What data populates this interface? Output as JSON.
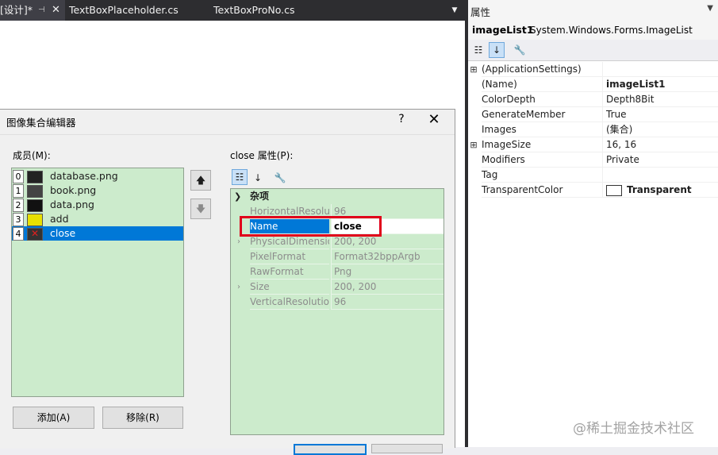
{
  "tabs": [
    {
      "label": "[设计]*",
      "active": true
    },
    {
      "label": "TextBoxPlaceholder.cs",
      "active": false
    },
    {
      "label": "TextBoxProNo.cs",
      "active": false
    }
  ],
  "dialog": {
    "title": "图像集合编辑器",
    "help": "?",
    "close": "✕",
    "members_label": "成员(M):",
    "props_label": "close 属性(P):",
    "members": [
      {
        "index": "0",
        "name": "database.png",
        "selected": false
      },
      {
        "index": "1",
        "name": "book.png",
        "selected": false
      },
      {
        "index": "2",
        "name": "data.png",
        "selected": false
      },
      {
        "index": "3",
        "name": "add",
        "selected": false
      },
      {
        "index": "4",
        "name": "close",
        "selected": true
      }
    ],
    "move_up": "🡅",
    "move_down": "🡇",
    "add_button": "添加(A)",
    "remove_button": "移除(R)",
    "grid": {
      "category": "杂项",
      "rows": [
        {
          "name": "HorizontalResolu",
          "value": "96",
          "expand": ""
        },
        {
          "name": "Name",
          "value": "close",
          "expand": "",
          "selected": true
        },
        {
          "name": "PhysicalDimensio",
          "value": "200, 200",
          "expand": "›"
        },
        {
          "name": "PixelFormat",
          "value": "Format32bppArgb",
          "expand": ""
        },
        {
          "name": "RawFormat",
          "value": "Png",
          "expand": ""
        },
        {
          "name": "Size",
          "value": "200, 200",
          "expand": "›"
        },
        {
          "name": "VerticalResolutio",
          "value": "96",
          "expand": ""
        }
      ]
    }
  },
  "properties": {
    "title": "属性",
    "object_name": "imageList1",
    "object_type": "System.Windows.Forms.ImageList",
    "rows": [
      {
        "name": "(ApplicationSettings)",
        "value": "",
        "expand": "⊞",
        "bold": false
      },
      {
        "name": "(Name)",
        "value": "imageList1",
        "expand": "",
        "bold": true
      },
      {
        "name": "ColorDepth",
        "value": "Depth8Bit",
        "expand": "",
        "bold": false
      },
      {
        "name": "GenerateMember",
        "value": "True",
        "expand": "",
        "bold": false
      },
      {
        "name": "Images",
        "value": "(集合)",
        "expand": "",
        "bold": false
      },
      {
        "name": "ImageSize",
        "value": "16, 16",
        "expand": "⊞",
        "bold": false
      },
      {
        "name": "Modifiers",
        "value": "Private",
        "expand": "",
        "bold": false
      },
      {
        "name": "Tag",
        "value": "",
        "expand": "",
        "bold": false
      },
      {
        "name": "TransparentColor",
        "value": "Transparent",
        "expand": "",
        "bold": true,
        "swatch": true
      }
    ]
  },
  "watermark": "@稀土掘金技术社区",
  "colors": {
    "accent": "#0078d7",
    "grid_bg": "#ccebcc",
    "highlight": "#e0001a",
    "tab_bg": "#2d2d30"
  }
}
